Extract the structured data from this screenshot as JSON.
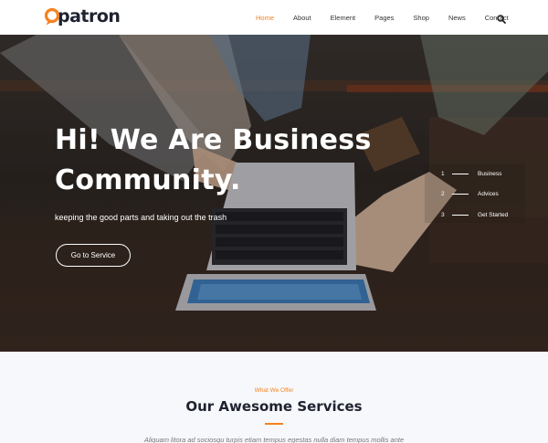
{
  "brand": {
    "name": "patron",
    "accent": "#f58220",
    "dark": "#1f2230"
  },
  "nav": {
    "items": [
      {
        "label": "Home",
        "active": true
      },
      {
        "label": "About"
      },
      {
        "label": "Element"
      },
      {
        "label": "Pages"
      },
      {
        "label": "Shop"
      },
      {
        "label": "News"
      },
      {
        "label": "Contact"
      }
    ],
    "search_icon": "search-icon"
  },
  "hero": {
    "title_line1": "Hi! We Are Business",
    "title_line2": "Community.",
    "subtitle": "keeping the good parts and taking out the trash",
    "button_label": "Go to Service",
    "slides": [
      {
        "num": "1",
        "label": "Business"
      },
      {
        "num": "2",
        "label": "Advices"
      },
      {
        "num": "3",
        "label": "Get Started"
      }
    ]
  },
  "services": {
    "kicker": "What We Offer",
    "title": "Our Awesome Services",
    "text": "Aliquam litora ad sociosqu turpis etiam tempus egestas nulla diam tempus mollis ante"
  }
}
